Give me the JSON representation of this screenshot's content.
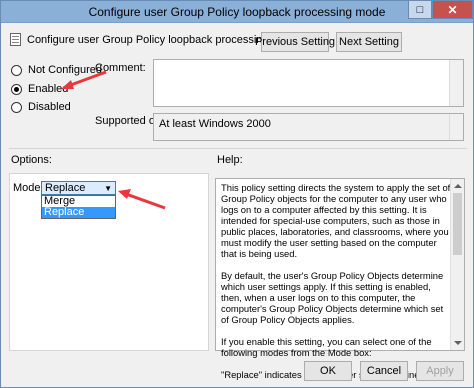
{
  "window": {
    "title": "Configure user Group Policy loopback processing mode",
    "maximize_glyph": "□",
    "close_glyph": "✕"
  },
  "header": {
    "setting_name": "Configure user Group Policy loopback processing mode",
    "icon": "policy-document-icon",
    "previous_label": "Previous Setting",
    "next_label": "Next Setting"
  },
  "state": {
    "options": [
      {
        "label": "Not Configured",
        "checked": false
      },
      {
        "label": "Enabled",
        "checked": true
      },
      {
        "label": "Disabled",
        "checked": false
      }
    ]
  },
  "comment": {
    "label": "Comment:",
    "value": ""
  },
  "supported": {
    "label": "Supported on:",
    "value": "At least Windows 2000"
  },
  "options_section": {
    "label": "Options:",
    "mode_label": "Mode:",
    "selected": "Replace",
    "items": [
      "Merge",
      "Replace"
    ]
  },
  "help_section": {
    "label": "Help:",
    "text": "This policy setting directs the system to apply the set of Group Policy objects for the computer to any user who logs on to a computer affected by this setting. It is intended for special-use computers, such as those in public places, laboratories, and classrooms, where you must modify the user setting based on the computer that is being used.\n\nBy default, the user's Group Policy Objects determine which user settings apply. If this setting is enabled, then, when a user logs on to this computer, the computer's Group Policy Objects determine which set of Group Policy Objects applies.\n\nIf you enable this setting, you can select one of the following modes from the Mode box:\n\n\"Replace\" indicates that the user settings defined in the"
  },
  "footer": {
    "ok_label": "OK",
    "cancel_label": "Cancel",
    "apply_label": "Apply"
  },
  "colors": {
    "annotation_arrow": "#e8383d",
    "dropdown_highlight": "#3399ff"
  }
}
